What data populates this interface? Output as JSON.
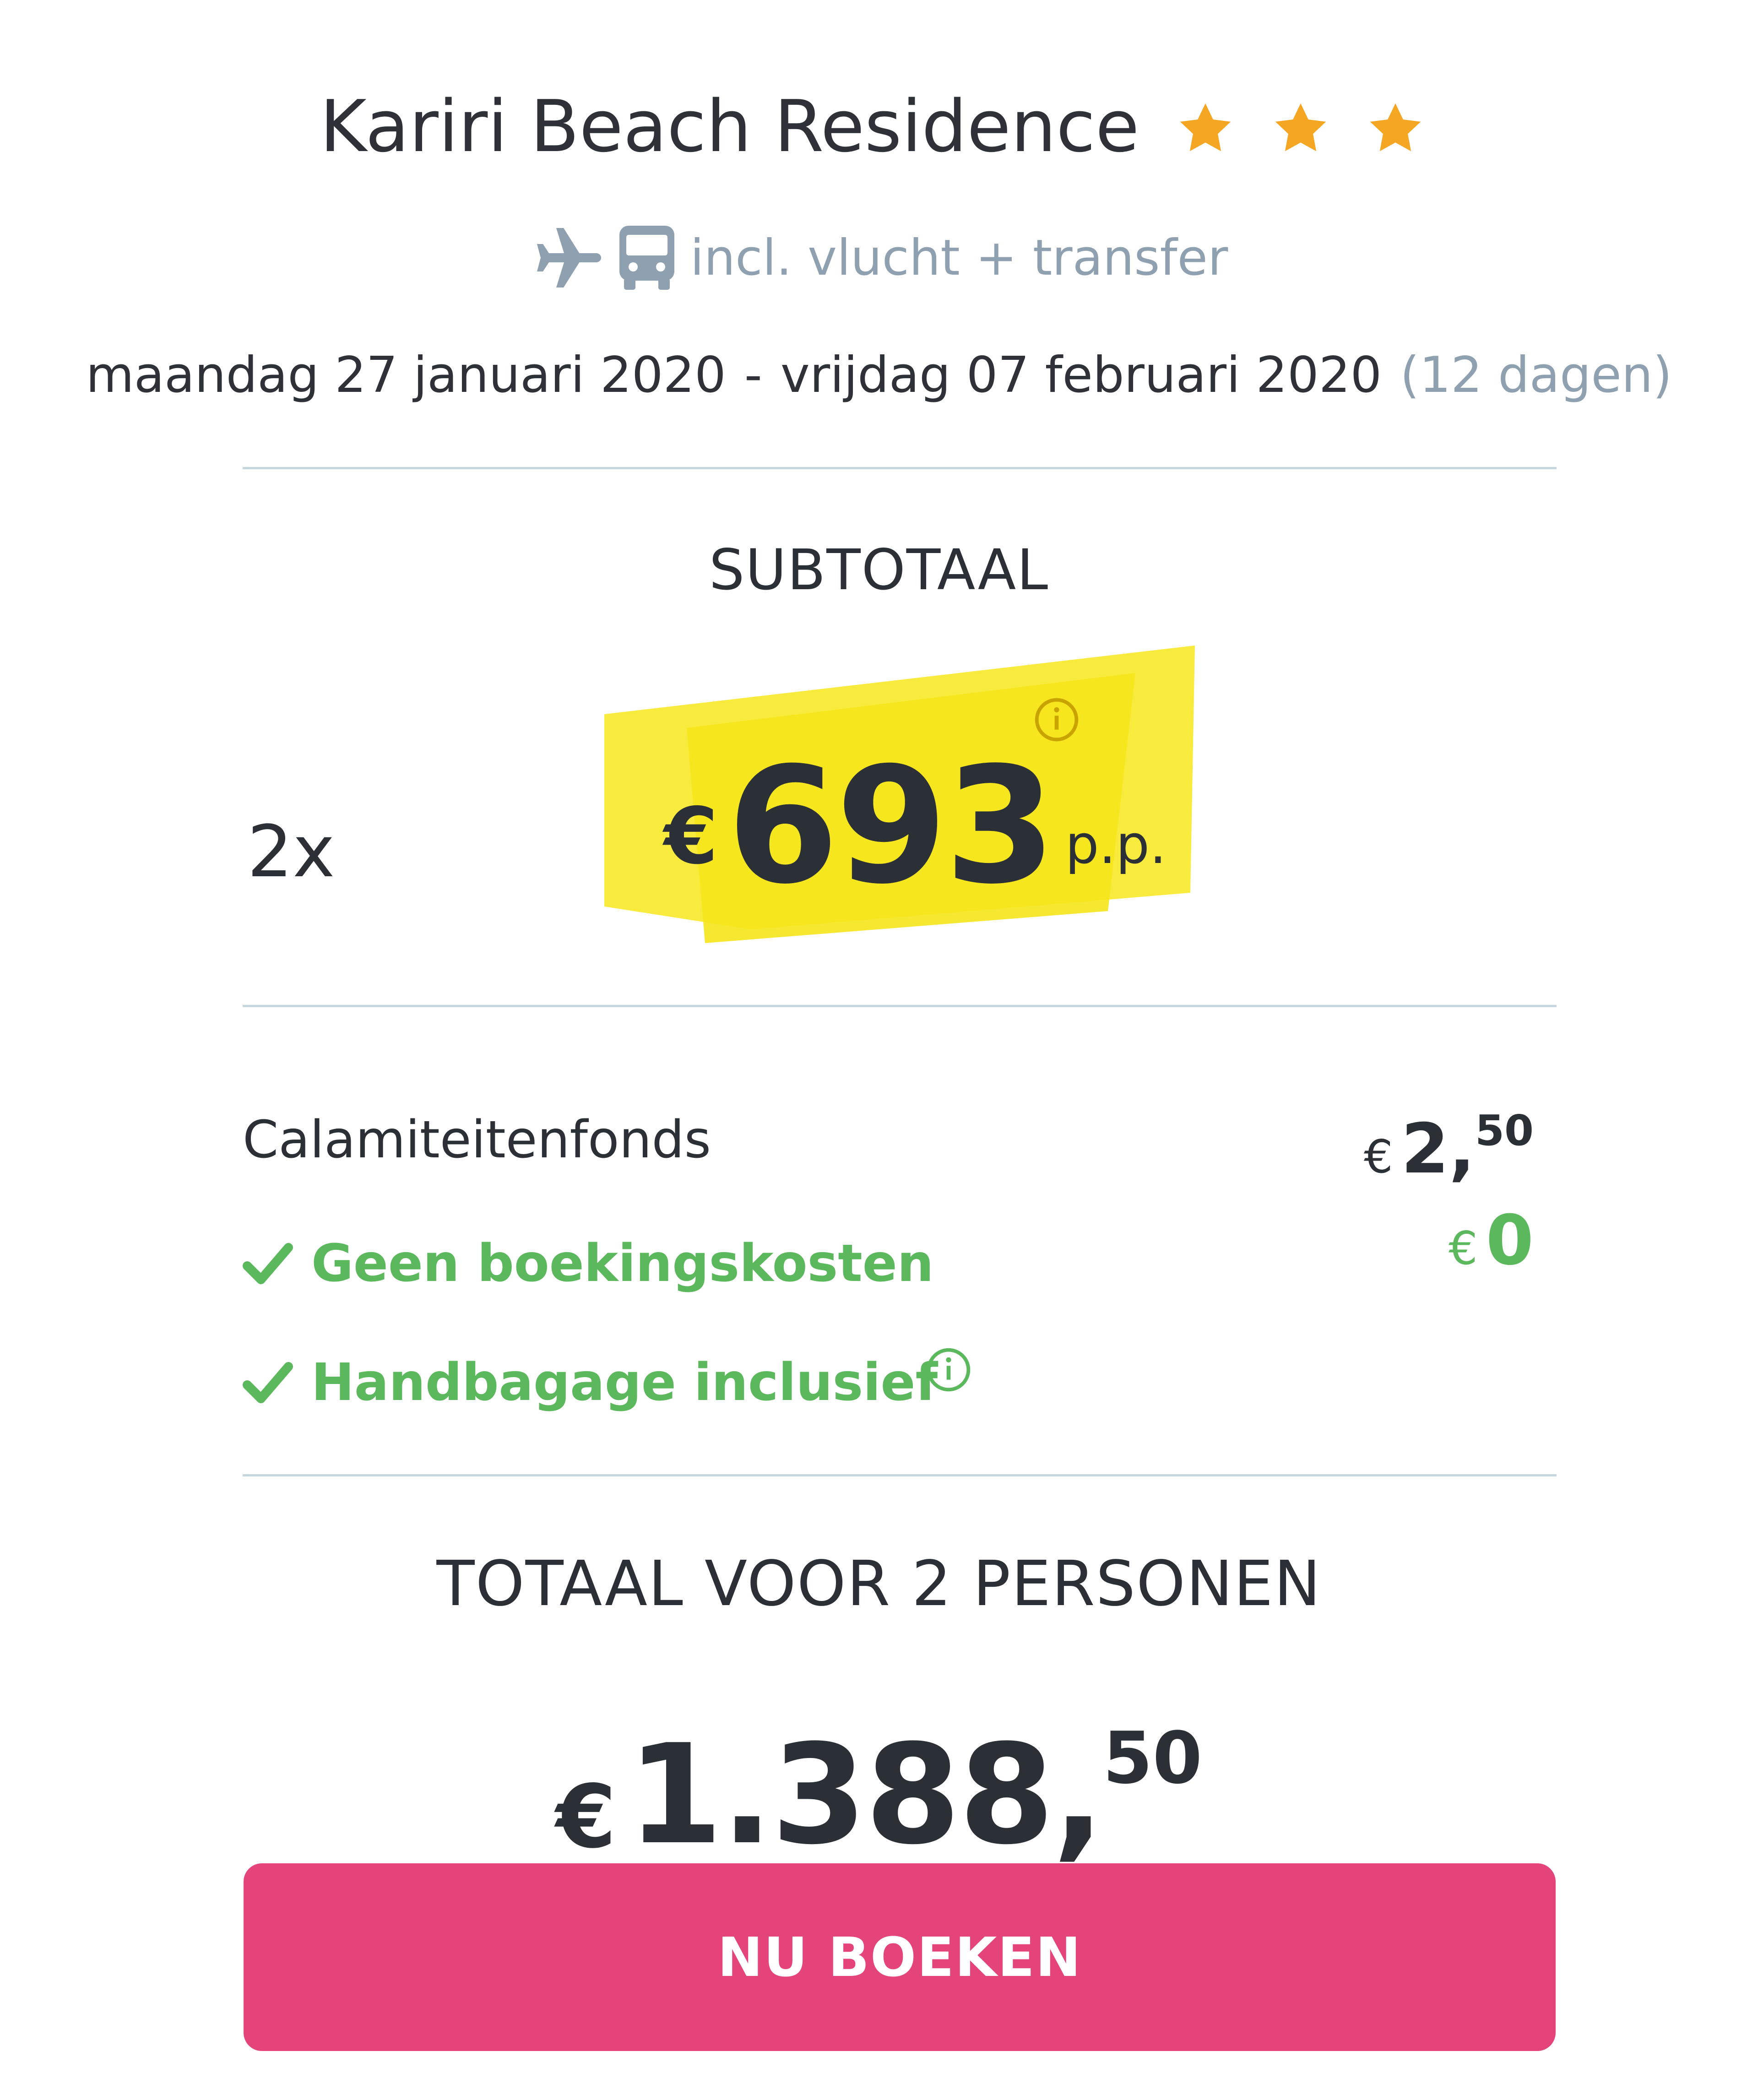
{
  "hotel": {
    "name": "Kariri Beach Residence",
    "stars": 3,
    "star_color": "#f5a623"
  },
  "includes": {
    "icons": [
      "airplane-icon",
      "bus-icon"
    ],
    "text": "incl. vlucht + transfer"
  },
  "dates": {
    "start": "maandag 27 januari 2020",
    "separator": "-",
    "end": "vrijdag 07 februari 2020",
    "duration": "(12 dagen)"
  },
  "subtotal": {
    "label": "SUBTOTAAL",
    "quantity": "2x",
    "currency": "€",
    "amount": "693",
    "per_person": "p.p.",
    "highlight_color": "#f8e71c"
  },
  "fees": {
    "calamity": {
      "label": "Calamiteitenfonds",
      "currency": "€",
      "amount_int": "2,",
      "amount_dec": "50"
    },
    "booking_costs": {
      "label": "Geen boekingskosten",
      "currency": "€",
      "amount": "0"
    },
    "hand_luggage": {
      "label": "Handbagage inclusief"
    },
    "accent_color": "#5cb85c"
  },
  "total": {
    "label": "TOTAAL VOOR 2 PERSONEN",
    "currency": "€",
    "amount_int": "1.388,",
    "amount_dec": "50"
  },
  "cta": {
    "label": "NU BOEKEN",
    "color": "#e5447a"
  },
  "divider_color": "#c7d7df"
}
